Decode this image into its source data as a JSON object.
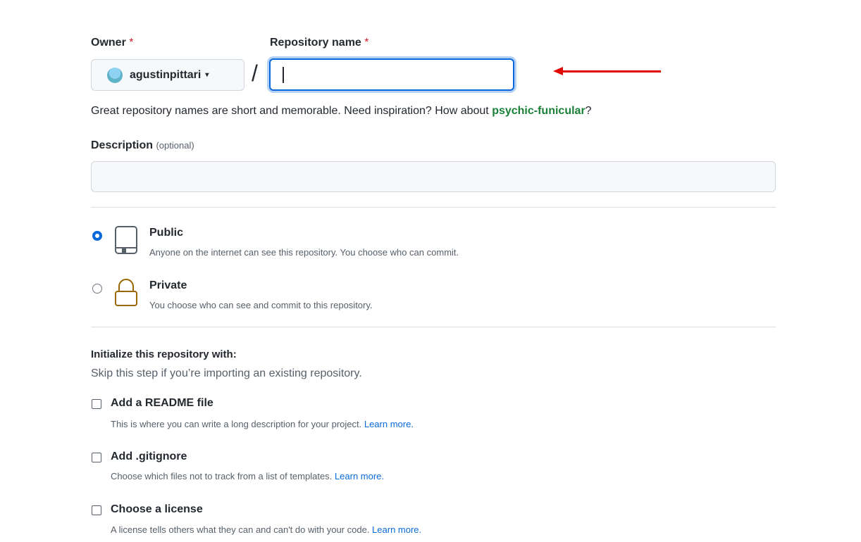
{
  "owner": {
    "label": "Owner",
    "required_mark": "*",
    "value": "agustinpittari",
    "caret": "▾"
  },
  "repository": {
    "label": "Repository name",
    "required_mark": "*",
    "separator": "/",
    "value": ""
  },
  "hint": {
    "prefix": "Great repository names are short and memorable. Need inspiration? How about ",
    "suggestion": "psychic-funicular",
    "suffix": "?"
  },
  "description": {
    "label": "Description",
    "optional": "(optional)",
    "value": ""
  },
  "visibility": {
    "selected": "public",
    "options": [
      {
        "title": "Public",
        "description": "Anyone on the internet can see this repository. You choose who can commit."
      },
      {
        "title": "Private",
        "description": "You choose who can see and commit to this repository."
      }
    ]
  },
  "initialize": {
    "heading": "Initialize this repository with:",
    "subheading": "Skip this step if you’re importing an existing repository.",
    "options": [
      {
        "title": "Add a README file",
        "description": "This is where you can write a long description for your project.",
        "link": "Learn more.",
        "checked": false
      },
      {
        "title": "Add .gitignore",
        "description": "Choose which files not to track from a list of templates.",
        "link": "Learn more.",
        "checked": false
      },
      {
        "title": "Choose a license",
        "description": "A license tells others what they can and can't do with your code.",
        "link": "Learn more.",
        "checked": false
      }
    ]
  },
  "annotation": {
    "arrow_color": "#e10600"
  },
  "colors": {
    "accent": "#0969da",
    "suggestion": "#1a7f37",
    "required": "#cf222e"
  }
}
